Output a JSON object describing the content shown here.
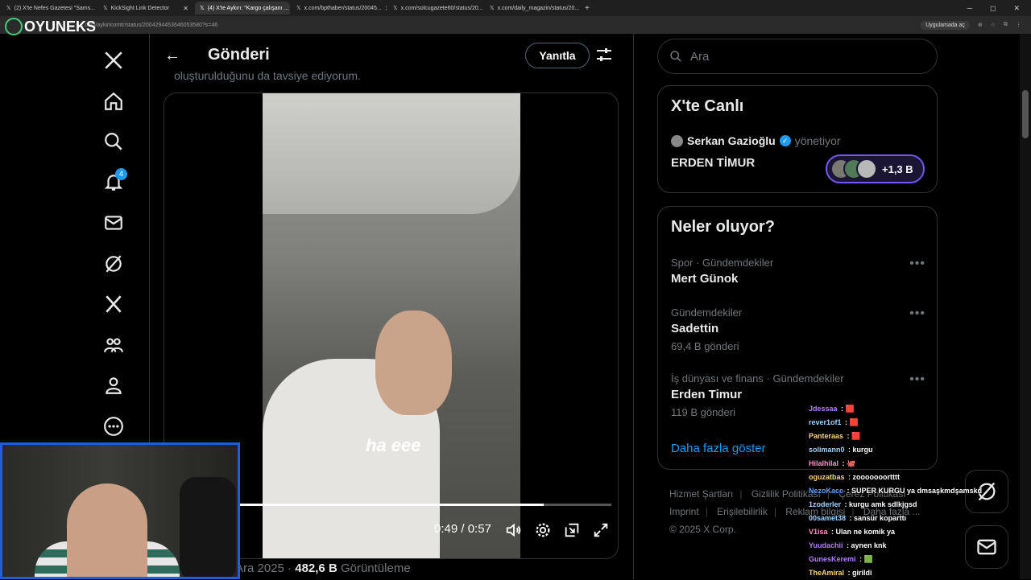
{
  "browser": {
    "tabs": [
      {
        "title": "(2) X'te Nefes Gazetesi \"Sams...",
        "active": false
      },
      {
        "title": "KickSight Link Detector",
        "active": false
      },
      {
        "title": "(4) X'te Aykırı: \"Kargo çalışanı ...",
        "active": true
      },
      {
        "title": "x.com/bpthaber/status/20045...",
        "active": false
      },
      {
        "title": "x.com/solcugazete60/status/20...",
        "active": false
      },
      {
        "title": "x.com/daily_magazin/status/20...",
        "active": false
      }
    ],
    "url": "x.com/aykiricomtr/status/2004294453646053580?s=46",
    "app_button": "Uygulamada aç"
  },
  "overlay_logo": "OYUNEKS",
  "nav": {
    "icons": [
      "x-logo-icon",
      "home-icon",
      "search-icon",
      "notifications-icon",
      "messages-icon",
      "grok-icon",
      "premium-x-icon",
      "communities-icon",
      "profile-icon",
      "more-icon"
    ],
    "notification_count": "4"
  },
  "main": {
    "title": "Gönderi",
    "reply_label": "Yanıtla",
    "faded_text": "oluşturulduğunu da tavsiye ediyorum.",
    "video": {
      "caption": "ha eee",
      "current_time": "0:49",
      "separator": "/",
      "duration": "0:57",
      "progress_fraction": 0.82
    },
    "stats": {
      "date": "Ara 2025",
      "views": "482,6 B",
      "views_label": "Görüntüleme"
    }
  },
  "right": {
    "search_placeholder": "Ara",
    "live": {
      "title": "X'te Canlı",
      "host": "Serkan Gazioğlu",
      "host_role": "yönetiyor",
      "space_name": "ERDEN TİMUR",
      "listener_count": "+1,3 B"
    },
    "trends": {
      "title": "Neler oluyor?",
      "items": [
        {
          "meta": "Spor · Gündemdekiler",
          "name": "Mert Günok",
          "count": ""
        },
        {
          "meta": "Gündemdekiler",
          "name": "Sadettin",
          "count": "69,4 B gönderi"
        },
        {
          "meta": "İş dünyası ve finans · Gündemdekiler",
          "name": "Erden Timur",
          "count": "119 B gönderi"
        }
      ],
      "show_more": "Daha fazla göster"
    },
    "footer": {
      "links_row1": [
        "Hizmet Şartları",
        "Gizlilik Politikası",
        "Çerez Politikası"
      ],
      "links_row2": [
        "Imprint",
        "Erişilebilirlik",
        "Reklam bilgisi",
        "Daha fazla ..."
      ],
      "copyright": "© 2025 X Corp."
    }
  },
  "chat": [
    {
      "user": "Jdessaa",
      "msg": "",
      "color": "#b57cff",
      "emote": "🟥"
    },
    {
      "user": "rever1of1",
      "msg": "",
      "color": "#9fd3ff",
      "emote": "🟥"
    },
    {
      "user": "Panteraas",
      "msg": "",
      "color": "#ffd37a",
      "emote": "🟥"
    },
    {
      "user": "solimann0",
      "msg": "kurgu",
      "color": "#9fd3ff",
      "emote": ""
    },
    {
      "user": "Hilalhilal",
      "msg": "",
      "color": "#ff8fc8",
      "emote": "🐙"
    },
    {
      "user": "oguzatbas",
      "msg": "zooooooortttt",
      "color": "#ffd37a",
      "emote": ""
    },
    {
      "user": "NezoKacc",
      "msg": "SUPER KURGU ya dmsaşkmdşamskd",
      "color": "#5aa0ff",
      "emote": ""
    },
    {
      "user": "1zoderler",
      "msg": "kurgu amk sdlkjgsd",
      "color": "#9fd3ff",
      "emote": ""
    },
    {
      "user": "00samet38",
      "msg": "sansür koparttı",
      "color": "#9fd3ff",
      "emote": ""
    },
    {
      "user": "V1isa",
      "msg": "Ulan ne komik ya",
      "color": "#ff8fc8",
      "emote": ""
    },
    {
      "user": "Yuudachii",
      "msg": "aynen knk",
      "color": "#b57cff",
      "emote": ""
    },
    {
      "user": "GunesKeremi",
      "msg": "",
      "color": "#b57cff",
      "emote": "🟩"
    },
    {
      "user": "TheAmiral",
      "msg": "girildi",
      "color": "#ffd37a",
      "emote": ""
    }
  ]
}
